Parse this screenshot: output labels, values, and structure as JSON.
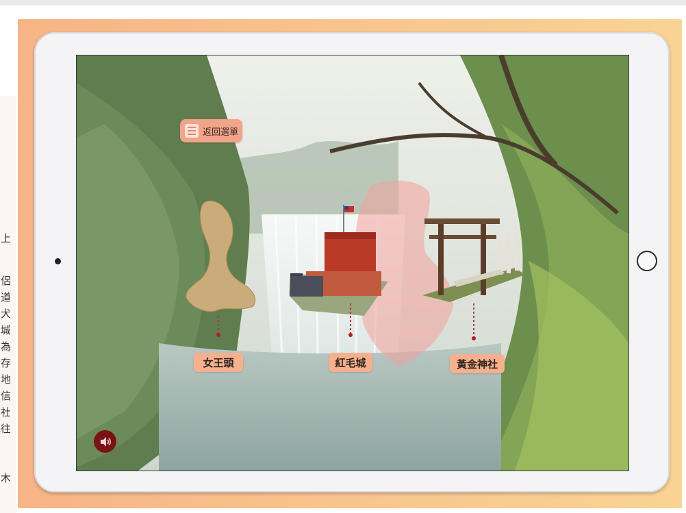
{
  "app": {
    "menu_button_label": "返回選單",
    "sound_icon": "speaker-icon"
  },
  "places": [
    {
      "name": "女王頭"
    },
    {
      "name": "紅毛城"
    },
    {
      "name": "黃金神社"
    }
  ],
  "background_doc_chars": [
    "上",
    "侶",
    "道",
    "犬",
    "城",
    "為",
    "存",
    "地",
    "信",
    "社",
    "往",
    "木"
  ],
  "colors": {
    "frame_orange": "#f7b486",
    "label_bg": "#f6b08e",
    "sound_button": "#7a1414",
    "fort_red": "#b83a26"
  }
}
